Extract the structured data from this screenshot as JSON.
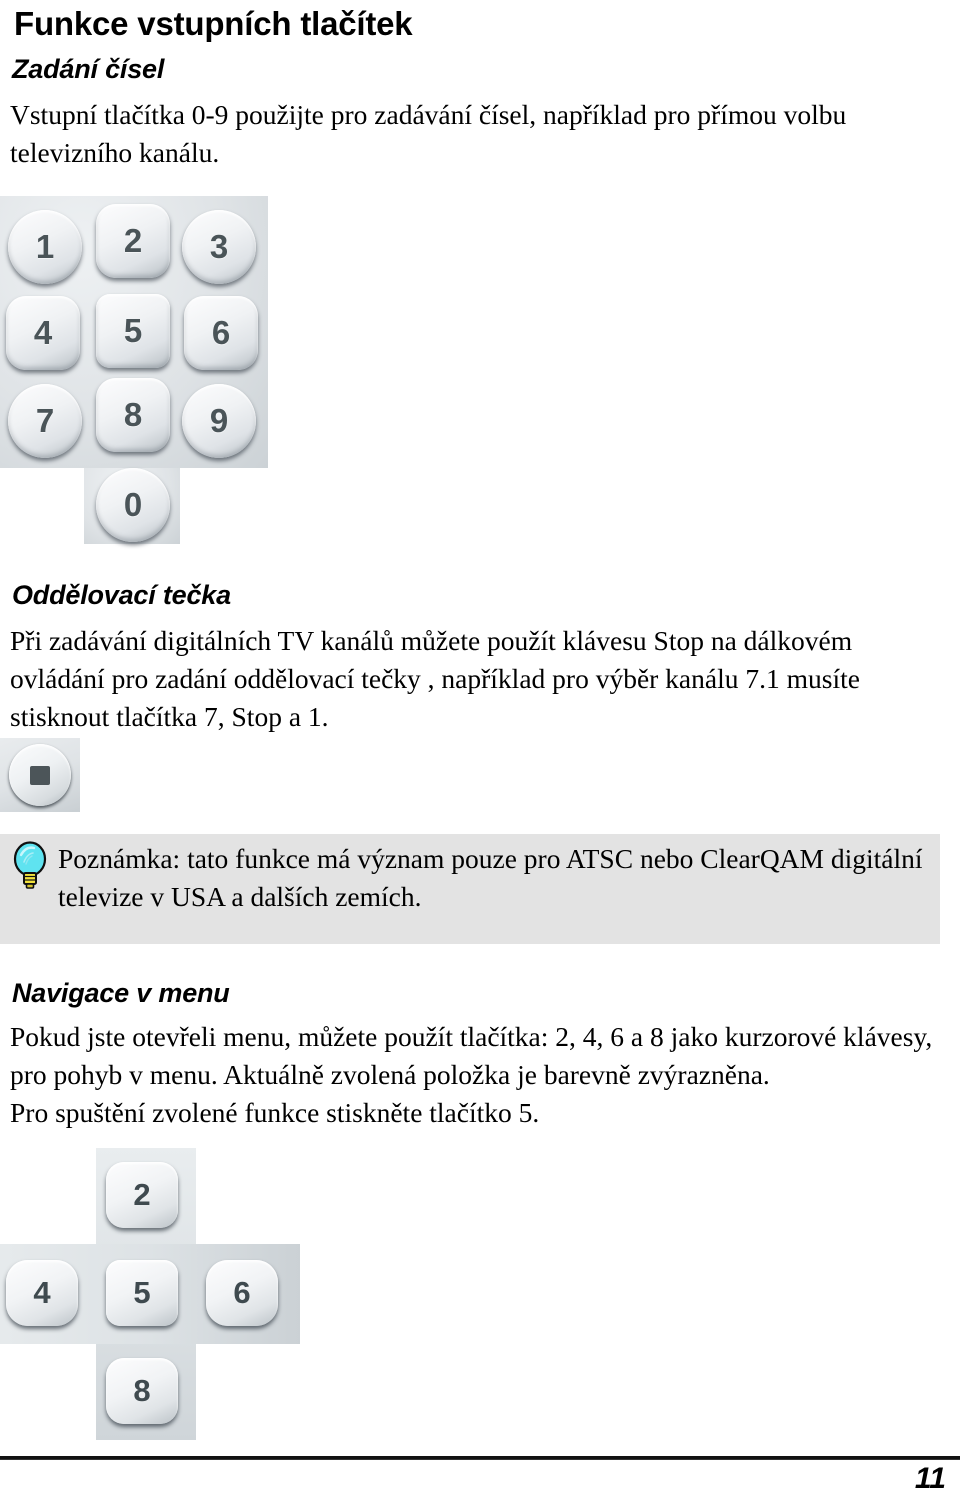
{
  "document": {
    "title": "Funkce vstupních tlačítek",
    "page_number": "11"
  },
  "sections": [
    {
      "heading": "Zadání čísel",
      "paragraph": "Vstupní tlačítka 0-9 použijte pro zadávání čísel, například pro přímou volbu televizního kanálu."
    },
    {
      "heading": "Oddělovací tečka",
      "paragraph": "Při zadávání digitálních TV kanálů můžete použít klávesu Stop na dálkovém ovládání pro zadání oddělovací tečky , například pro výběr kanálu 7.1 musíte stisknout tlačítka 7, Stop a 1."
    },
    {
      "heading": "Navigace v menu",
      "paragraph": "Pokud jste otevřeli menu, můžete použít tlačítka: 2, 4, 6 a 8 jako kurzorové klávesy, pro pohyb v menu. Aktuálně zvolená položka je barevně zvýrazněna.",
      "paragraph2": "Pro spuštění zvolené funkce stiskněte tlačítko 5."
    }
  ],
  "note": {
    "icon": "lightbulb-icon",
    "text": "Poznámka: tato funkce má význam pouze pro ATSC nebo ClearQAM digitální televize v USA a dalších zemích.",
    "background_color": "#e3e3e3",
    "bulb_color": "#5fe3f0",
    "bulb_base_color": "#f2e23c"
  },
  "figures": {
    "numeric_keypad": {
      "name": "numeric-keypad-photo",
      "keys": [
        "1",
        "2",
        "3",
        "4",
        "5",
        "6",
        "7",
        "8",
        "9",
        "0"
      ],
      "plate_color": "#dfe3e6",
      "digit_color": "#4a5458"
    },
    "stop_button": {
      "name": "stop-button-photo",
      "symbol": "stop-square-icon",
      "plate_color": "#dfe3e6"
    },
    "cursor_pad": {
      "name": "cursor-cross-keypad-photo",
      "keys": {
        "up": "2",
        "left": "4",
        "center": "5",
        "right": "6",
        "down": "8"
      },
      "plate_color": "#dde2e5",
      "digit_color": "#3f4a4f"
    }
  }
}
